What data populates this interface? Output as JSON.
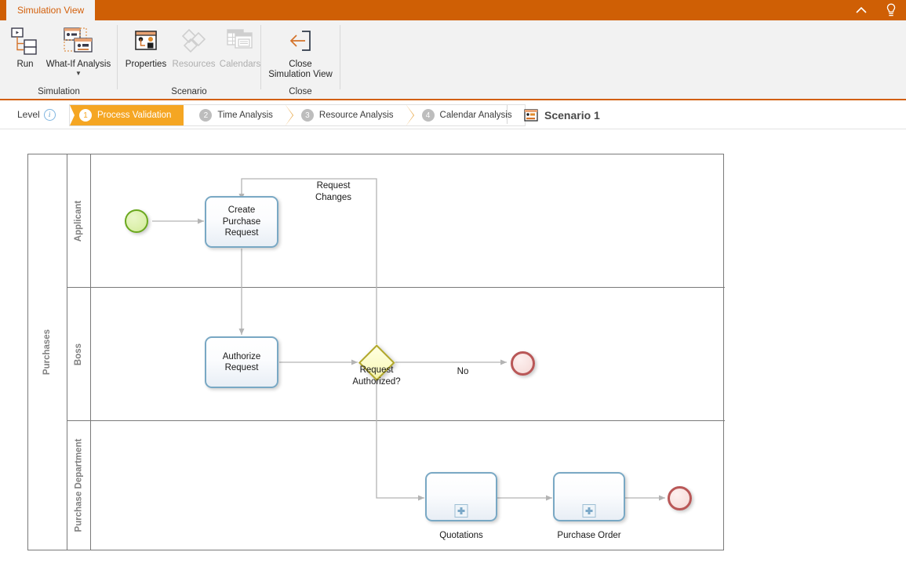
{
  "window": {
    "tab_label": "Simulation View",
    "collapse_icon": "chevron-up-icon",
    "help_icon": "lightbulb-icon",
    "accent_color": "#cf5f05",
    "tab_text_color": "#d35f0a"
  },
  "ribbon": {
    "groups": [
      {
        "name": "Simulation",
        "title": "Simulation",
        "buttons": [
          {
            "id": "run",
            "label": "Run",
            "icon": "run-icon",
            "enabled": true,
            "has_dropdown": false
          },
          {
            "id": "what-if-analysis",
            "label": "What-If Analysis",
            "icon": "what-if-analysis-icon",
            "enabled": true,
            "has_dropdown": true
          }
        ]
      },
      {
        "name": "Scenario",
        "title": "Scenario",
        "buttons": [
          {
            "id": "properties",
            "label": "Properties",
            "icon": "properties-icon",
            "enabled": true,
            "has_dropdown": false
          },
          {
            "id": "resources",
            "label": "Resources",
            "icon": "resources-icon",
            "enabled": false,
            "has_dropdown": false
          },
          {
            "id": "calendars",
            "label": "Calendars",
            "icon": "calendars-icon",
            "enabled": false,
            "has_dropdown": false
          }
        ]
      },
      {
        "name": "Close",
        "title": "Close",
        "buttons": [
          {
            "id": "close-simulation-view",
            "label": "Close\nSimulation View",
            "icon": "back-arrow-icon",
            "enabled": true,
            "has_dropdown": false
          }
        ]
      }
    ]
  },
  "levelbar": {
    "label": "Level",
    "info_icon": "info-icon",
    "steps": [
      {
        "num": "1",
        "label": "Process Validation",
        "active": true
      },
      {
        "num": "2",
        "label": "Time Analysis",
        "active": false
      },
      {
        "num": "3",
        "label": "Resource Analysis",
        "active": false
      },
      {
        "num": "4",
        "label": "Calendar Analysis",
        "active": false
      }
    ],
    "scenario": {
      "icon": "scenario-icon",
      "label": "Scenario 1"
    },
    "active_color": "#f5a623"
  },
  "diagram": {
    "pool": {
      "name": "Purchases"
    },
    "lanes": [
      {
        "id": "applicant",
        "name": "Applicant"
      },
      {
        "id": "boss",
        "name": "Boss"
      },
      {
        "id": "purchase-department",
        "name": "Purchase Department"
      }
    ],
    "nodes": {
      "start_event": {
        "type": "start-event",
        "label": ""
      },
      "create_purchase_request": {
        "type": "task",
        "label": "Create\nPurchase\nRequest"
      },
      "authorize_request": {
        "type": "task",
        "label": "Authorize\nRequest"
      },
      "request_authorized_gateway": {
        "type": "exclusive-gateway",
        "label": "Request\nAuthorized?"
      },
      "end_event_no": {
        "type": "end-event",
        "label": ""
      },
      "quotations": {
        "type": "sub-process",
        "label": "Quotations"
      },
      "purchase_order": {
        "type": "sub-process",
        "label": "Purchase Order"
      },
      "end_event_purchase": {
        "type": "end-event",
        "label": ""
      }
    },
    "flows": [
      {
        "id": "request-changes",
        "label": "Request\nChanges"
      },
      {
        "id": "no-flow",
        "label": "No"
      }
    ],
    "colors": {
      "task_border": "#79a8c4",
      "start_border": "#6aa81e",
      "end_border": "#b95757",
      "gateway_border": "#b2a82a",
      "lane_border": "#7a7a7a",
      "lane_text": "#808080"
    }
  }
}
